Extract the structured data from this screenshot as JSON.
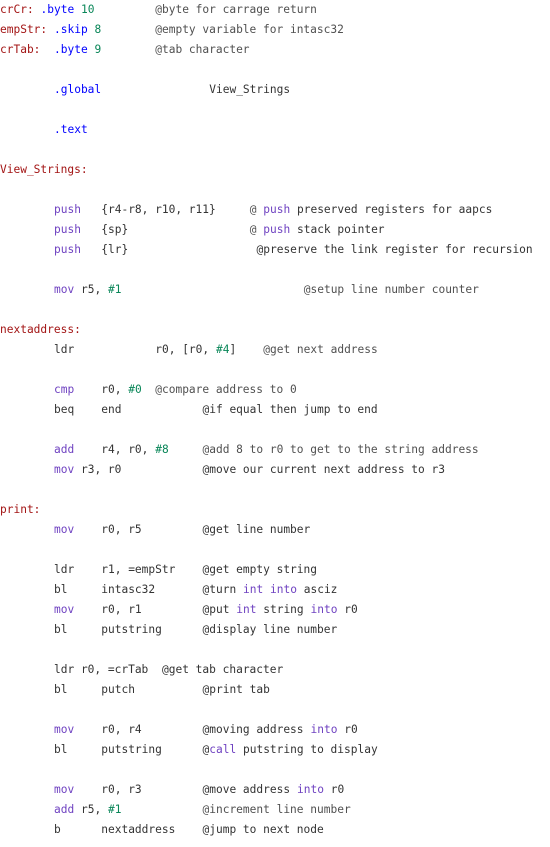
{
  "colors": {
    "label": "#a31515",
    "keyword": "#6f42c1",
    "directive": "#0000ff",
    "number": "#098658",
    "comment": "#505050",
    "text": "#333333",
    "background": "#ffffff"
  },
  "lines": [
    {
      "tokens": [
        {
          "t": "crCr:",
          "k": "label",
          "c": 0
        },
        {
          "t": ".byte",
          "k": "dir",
          "c": 6
        },
        {
          "t": "10",
          "k": "num",
          "c": 12
        },
        {
          "t": "@byte for carrage return",
          "k": "cm",
          "c": 23
        }
      ]
    },
    {
      "tokens": [
        {
          "t": "empStr:",
          "k": "label",
          "c": 0
        },
        {
          "t": ".skip",
          "k": "dir",
          "c": 8
        },
        {
          "t": "8",
          "k": "num",
          "c": 14
        },
        {
          "t": "@empty variable for intasc32",
          "k": "cm",
          "c": 23
        }
      ]
    },
    {
      "tokens": [
        {
          "t": "crTab:",
          "k": "label",
          "c": 0
        },
        {
          "t": ".byte",
          "k": "dir",
          "c": 8
        },
        {
          "t": "9",
          "k": "num",
          "c": 14
        },
        {
          "t": "@tab character",
          "k": "cm",
          "c": 23
        }
      ]
    },
    {
      "tokens": []
    },
    {
      "tokens": [
        {
          "t": ".global",
          "k": "dir",
          "c": 8
        },
        {
          "t": "View_Strings",
          "k": "txt",
          "c": 31
        }
      ]
    },
    {
      "tokens": []
    },
    {
      "tokens": [
        {
          "t": ".text",
          "k": "dir",
          "c": 8
        }
      ]
    },
    {
      "tokens": []
    },
    {
      "tokens": [
        {
          "t": "View_Strings:",
          "k": "label",
          "c": 0
        }
      ]
    },
    {
      "tokens": []
    },
    {
      "tokens": [
        {
          "t": "push",
          "k": "kw",
          "c": 8
        },
        {
          "t": "{r4-r8, r10, r11}",
          "k": "txt",
          "c": 15
        },
        {
          "t": "@ ",
          "k": "cm",
          "c": 37
        },
        {
          "t": "push",
          "k": "kw",
          "c": 39
        },
        {
          "t": " preserved registers for aapcs",
          "k": "txt",
          "c": 43
        }
      ]
    },
    {
      "tokens": [
        {
          "t": "push",
          "k": "kw",
          "c": 8
        },
        {
          "t": "{sp}",
          "k": "txt",
          "c": 15
        },
        {
          "t": "@ ",
          "k": "cm",
          "c": 37
        },
        {
          "t": "push",
          "k": "kw",
          "c": 39
        },
        {
          "t": " stack pointer",
          "k": "txt",
          "c": 43
        }
      ]
    },
    {
      "tokens": [
        {
          "t": "push",
          "k": "kw",
          "c": 8
        },
        {
          "t": "{lr}",
          "k": "txt",
          "c": 15
        },
        {
          "t": "@preserve the link register for recursion",
          "k": "txt",
          "c": 38
        }
      ]
    },
    {
      "tokens": []
    },
    {
      "tokens": [
        {
          "t": "mov",
          "k": "kw",
          "c": 8
        },
        {
          "t": " r5, ",
          "k": "txt",
          "c": 11
        },
        {
          "t": "#1",
          "k": "num",
          "c": 16
        },
        {
          "t": "@setup line number counter",
          "k": "cm",
          "c": 45
        }
      ]
    },
    {
      "tokens": []
    },
    {
      "tokens": [
        {
          "t": "nextaddress:",
          "k": "label",
          "c": 0
        }
      ]
    },
    {
      "tokens": [
        {
          "t": "ldr",
          "k": "txt",
          "c": 8
        },
        {
          "t": "r0, [r0, ",
          "k": "txt",
          "c": 23
        },
        {
          "t": "#4",
          "k": "num",
          "c": 32
        },
        {
          "t": "]",
          "k": "txt",
          "c": 34
        },
        {
          "t": "@get next address",
          "k": "cm",
          "c": 39
        }
      ]
    },
    {
      "tokens": []
    },
    {
      "tokens": [
        {
          "t": "cmp",
          "k": "kw",
          "c": 8
        },
        {
          "t": "r0, ",
          "k": "txt",
          "c": 15
        },
        {
          "t": "#0",
          "k": "num",
          "c": 19
        },
        {
          "t": "@compare address to 0",
          "k": "cm",
          "c": 23
        }
      ]
    },
    {
      "tokens": [
        {
          "t": "beq",
          "k": "txt",
          "c": 8
        },
        {
          "t": "end",
          "k": "txt",
          "c": 15
        },
        {
          "t": "@if equal then jump to end",
          "k": "txt",
          "c": 30
        }
      ]
    },
    {
      "tokens": []
    },
    {
      "tokens": [
        {
          "t": "add",
          "k": "kw",
          "c": 8
        },
        {
          "t": "r4, r0, ",
          "k": "txt",
          "c": 15
        },
        {
          "t": "#8",
          "k": "num",
          "c": 23
        },
        {
          "t": "@add 8 to r0 to get to the string address",
          "k": "cm",
          "c": 30
        }
      ]
    },
    {
      "tokens": [
        {
          "t": "mov",
          "k": "kw",
          "c": 8
        },
        {
          "t": " r3, r0",
          "k": "txt",
          "c": 11
        },
        {
          "t": "@move our current next address to r3",
          "k": "txt",
          "c": 30
        }
      ]
    },
    {
      "tokens": []
    },
    {
      "tokens": [
        {
          "t": "print:",
          "k": "label",
          "c": 0
        }
      ]
    },
    {
      "tokens": [
        {
          "t": "mov",
          "k": "kw",
          "c": 8
        },
        {
          "t": "r0, r5",
          "k": "txt",
          "c": 15
        },
        {
          "t": "@get line number",
          "k": "txt",
          "c": 30
        }
      ]
    },
    {
      "tokens": []
    },
    {
      "tokens": [
        {
          "t": "ldr",
          "k": "txt",
          "c": 8
        },
        {
          "t": "r1, =empStr",
          "k": "txt",
          "c": 15
        },
        {
          "t": "@get empty string",
          "k": "txt",
          "c": 30
        }
      ]
    },
    {
      "tokens": [
        {
          "t": "bl",
          "k": "txt",
          "c": 8
        },
        {
          "t": "intasc32",
          "k": "txt",
          "c": 15
        },
        {
          "t": "@turn ",
          "k": "txt",
          "c": 30
        },
        {
          "t": "int",
          "k": "kw",
          "c": 36
        },
        {
          "t": " ",
          "k": "txt",
          "c": 39
        },
        {
          "t": "into",
          "k": "kw",
          "c": 40
        },
        {
          "t": " asciz",
          "k": "txt",
          "c": 44
        }
      ]
    },
    {
      "tokens": [
        {
          "t": "mov",
          "k": "kw",
          "c": 8
        },
        {
          "t": "r0, r1",
          "k": "txt",
          "c": 15
        },
        {
          "t": "@put ",
          "k": "txt",
          "c": 30
        },
        {
          "t": "int",
          "k": "kw",
          "c": 35
        },
        {
          "t": " string ",
          "k": "txt",
          "c": 38
        },
        {
          "t": "into",
          "k": "kw",
          "c": 46
        },
        {
          "t": " r0",
          "k": "txt",
          "c": 50
        }
      ]
    },
    {
      "tokens": [
        {
          "t": "bl",
          "k": "txt",
          "c": 8
        },
        {
          "t": "putstring",
          "k": "txt",
          "c": 15
        },
        {
          "t": "@display line number",
          "k": "txt",
          "c": 30
        }
      ]
    },
    {
      "tokens": []
    },
    {
      "tokens": [
        {
          "t": "ldr r0, =crTab",
          "k": "txt",
          "c": 8
        },
        {
          "t": "@get tab character",
          "k": "txt",
          "c": 24
        }
      ]
    },
    {
      "tokens": [
        {
          "t": "bl",
          "k": "txt",
          "c": 8
        },
        {
          "t": "putch",
          "k": "txt",
          "c": 15
        },
        {
          "t": "@print tab",
          "k": "txt",
          "c": 30
        }
      ]
    },
    {
      "tokens": []
    },
    {
      "tokens": [
        {
          "t": "mov",
          "k": "kw",
          "c": 8
        },
        {
          "t": "r0, r4",
          "k": "txt",
          "c": 15
        },
        {
          "t": "@moving address ",
          "k": "txt",
          "c": 30
        },
        {
          "t": "into",
          "k": "kw",
          "c": 46
        },
        {
          "t": " r0",
          "k": "txt",
          "c": 50
        }
      ]
    },
    {
      "tokens": [
        {
          "t": "bl",
          "k": "txt",
          "c": 8
        },
        {
          "t": "putstring",
          "k": "txt",
          "c": 15
        },
        {
          "t": "@",
          "k": "txt",
          "c": 30
        },
        {
          "t": "call",
          "k": "kw",
          "c": 31
        },
        {
          "t": " putstring to display",
          "k": "txt",
          "c": 35
        }
      ]
    },
    {
      "tokens": []
    },
    {
      "tokens": [
        {
          "t": "mov",
          "k": "kw",
          "c": 8
        },
        {
          "t": "r0, r3",
          "k": "txt",
          "c": 15
        },
        {
          "t": "@move address ",
          "k": "txt",
          "c": 30
        },
        {
          "t": "into",
          "k": "kw",
          "c": 44
        },
        {
          "t": " r0",
          "k": "txt",
          "c": 48
        }
      ]
    },
    {
      "tokens": [
        {
          "t": "add",
          "k": "kw",
          "c": 8
        },
        {
          "t": " r5, ",
          "k": "txt",
          "c": 11
        },
        {
          "t": "#1",
          "k": "num",
          "c": 16
        },
        {
          "t": "@increment line number",
          "k": "cm",
          "c": 30
        }
      ]
    },
    {
      "tokens": [
        {
          "t": "b",
          "k": "txt",
          "c": 8
        },
        {
          "t": "nextaddress",
          "k": "txt",
          "c": 15
        },
        {
          "t": "@jump to next node",
          "k": "txt",
          "c": 30
        }
      ]
    }
  ]
}
